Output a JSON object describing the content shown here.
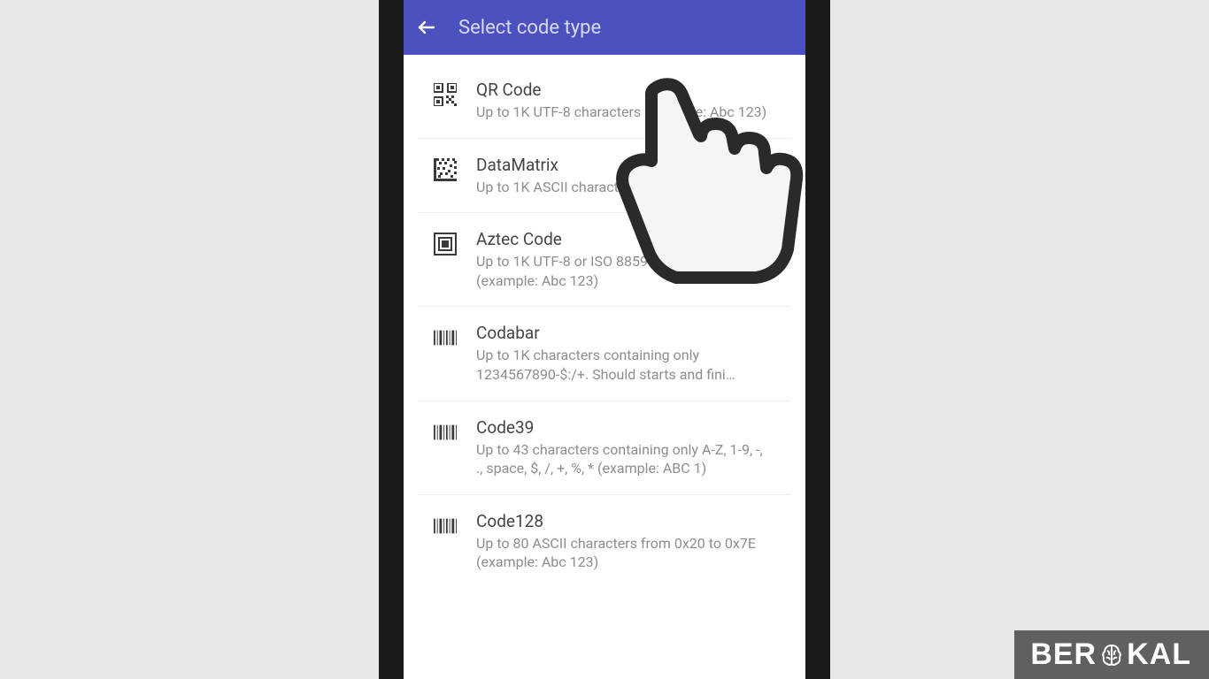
{
  "header": {
    "title": "Select code type"
  },
  "items": [
    {
      "icon": "qr",
      "title": "QR Code",
      "desc": "Up to 1K UTF-8 characters (example: Abc 123)"
    },
    {
      "icon": "datamatrix",
      "title": "DataMatrix",
      "desc": "Up to 1K ASCII characters (example: Abc 123)"
    },
    {
      "icon": "aztec",
      "title": "Aztec Code",
      "desc": "Up to 1K UTF-8 or ISO 8859−1 characters (example: Abc 123)"
    },
    {
      "icon": "barcode",
      "title": "Codabar",
      "desc": "Up to 1K characters containing only 1234567890-$:/+. Should starts and fini…"
    },
    {
      "icon": "barcode",
      "title": "Code39",
      "desc": "Up to 43 characters containing only A-Z, 1-9, -, ., space, $, /, +, %, * (example: ABC 1)"
    },
    {
      "icon": "barcode",
      "title": "Code128",
      "desc": "Up to 80 ASCII characters from 0x20 to 0x7E (example: Abc 123)"
    }
  ],
  "watermark": {
    "pre": "BER",
    "post": "KAL"
  }
}
